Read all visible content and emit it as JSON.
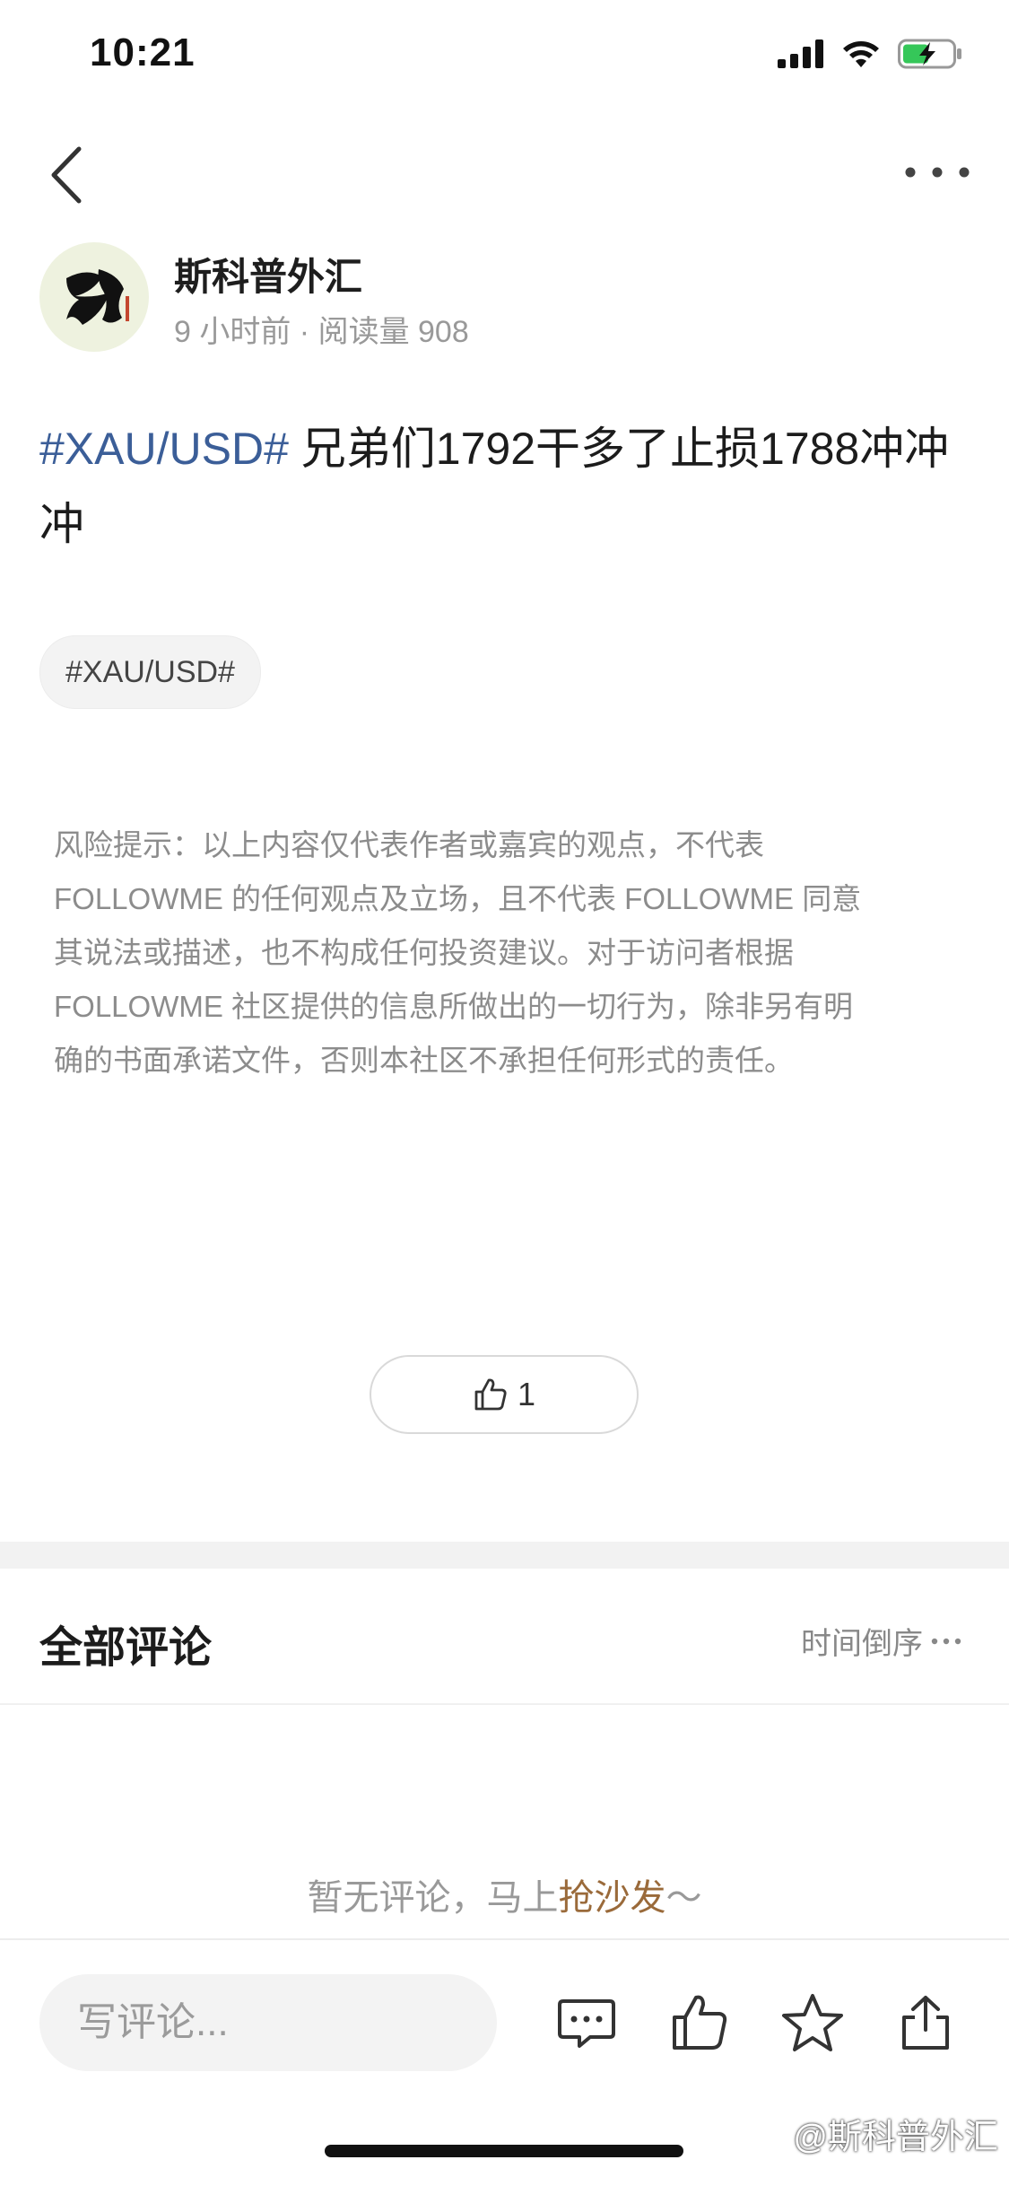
{
  "status_bar": {
    "time": "10:21"
  },
  "author": {
    "name": "斯科普外汇",
    "meta": "9 小时前 · 阅读量 908"
  },
  "post": {
    "hashtag": "#XAU/USD#",
    "text": " 兄弟们1792干多了止损1788冲冲冲",
    "tag_chip": "#XAU/USD#"
  },
  "disclaimer": {
    "lines": [
      "风险提示：以上内容仅代表作者或嘉宾的观点，不代表",
      "FOLLOWME 的任何观点及立场，且不代表 FOLLOWME 同意",
      "其说法或描述，也不构成任何投资建议。对于访问者根据",
      "FOLLOWME 社区提供的信息所做出的一切行为，除非另有明",
      "确的书面承诺文件，否则本社区不承担任何形式的责任。"
    ]
  },
  "like": {
    "count": "1"
  },
  "comments": {
    "title": "全部评论",
    "sort_label": "时间倒序",
    "empty_prefix": "暂无评论，马上",
    "empty_link": "抢沙发",
    "empty_suffix": "～"
  },
  "bottom_bar": {
    "placeholder": "写评论..."
  },
  "watermark": {
    "text": "@斯科普外汇"
  },
  "icons": [
    "back-icon",
    "more-icon",
    "like-icon",
    "comment-icon",
    "thumb-up-icon",
    "star-icon",
    "share-icon",
    "signal-icon",
    "wifi-icon",
    "battery-icon"
  ],
  "colors": {
    "hashtag": "#3b5e98",
    "accent": "#9a6a3a"
  }
}
